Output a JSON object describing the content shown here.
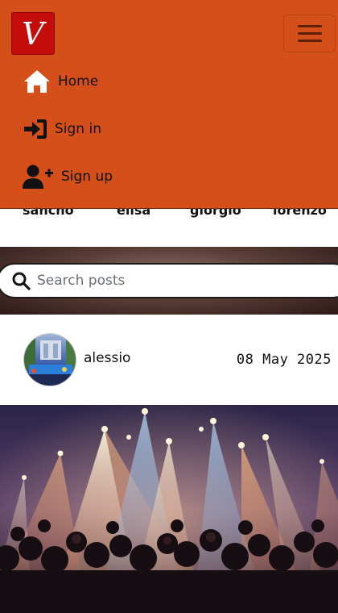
{
  "brand": {
    "logo_letter": "V"
  },
  "nav": {
    "toggle_label": "Toggle navigation",
    "items": [
      {
        "label": "Home",
        "icon": "home-icon"
      },
      {
        "label": "Sign in",
        "icon": "sign-in-icon"
      },
      {
        "label": "Sign up",
        "icon": "user-plus-icon"
      }
    ]
  },
  "users": [
    "sancho",
    "elisa",
    "giorgio",
    "lorenzo"
  ],
  "search": {
    "placeholder": "Search posts",
    "value": "",
    "icon": "search-icon"
  },
  "post": {
    "author": "alessio",
    "date": "08 May 2025"
  },
  "colors": {
    "nav_background": "#d44f19",
    "logo_background": "#c40d0b",
    "page_background": "#ffffff"
  }
}
